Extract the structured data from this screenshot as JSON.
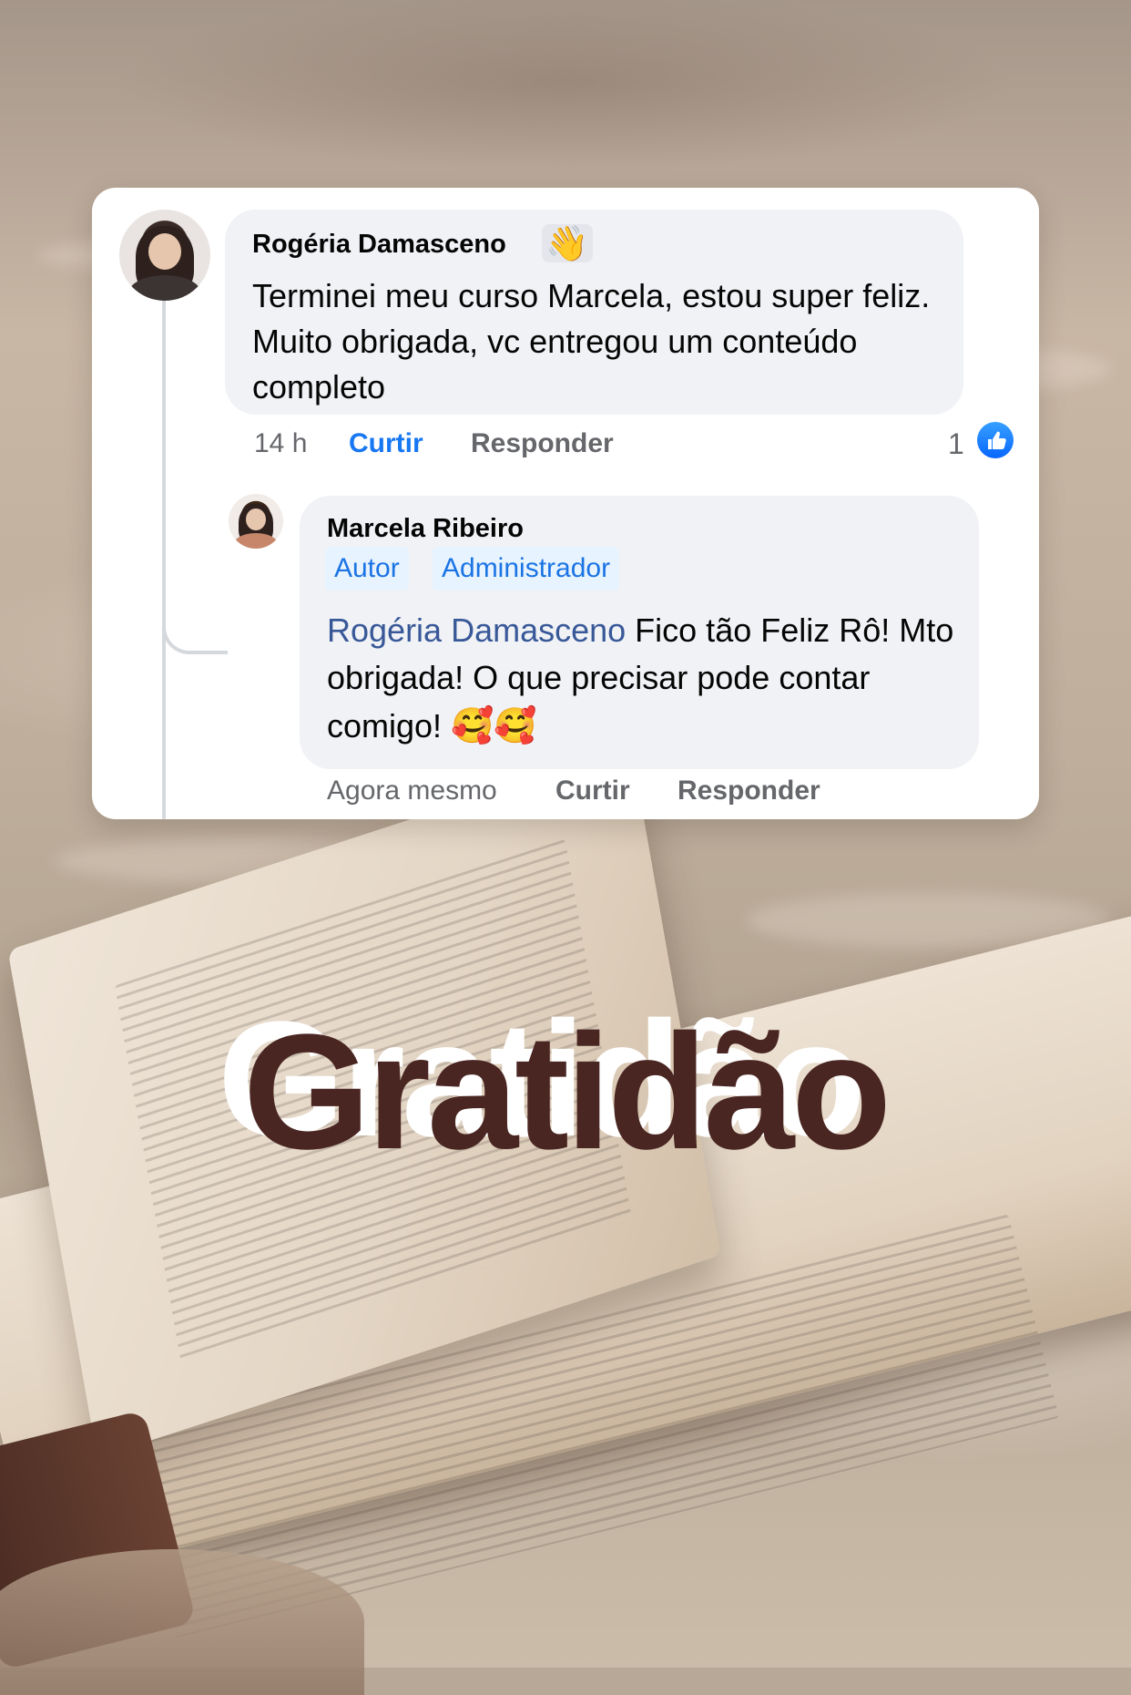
{
  "comment": {
    "author": "Rogéria Damasceno",
    "author_badge_icon": "waving-hand-icon",
    "text": "Terminei meu curso Marcela, estou super feliz. Muito obrigada, vc entregou um conteúdo completo",
    "time": "14 h",
    "like_action": "Curtir",
    "reply_action": "Responder",
    "reaction_count": "1",
    "reaction_icon": "like-icon"
  },
  "reply": {
    "author": "Marcela Ribeiro",
    "badges": [
      "Autor",
      "Administrador"
    ],
    "mention": "Rogéria Damasceno",
    "text": " Fico tão Feliz Rô! Mto obrigada! O que precisar pode contar comigo! ",
    "emojis": "🥰🥰",
    "time": "Agora mesmo",
    "like_action": "Curtir",
    "reply_action": "Responder"
  },
  "overlay_title": "Gratidão",
  "colors": {
    "link_blue": "#1877f2",
    "mention_blue": "#385898",
    "title_brown": "#4a2622",
    "bubble_gray": "#f0f2f5"
  }
}
